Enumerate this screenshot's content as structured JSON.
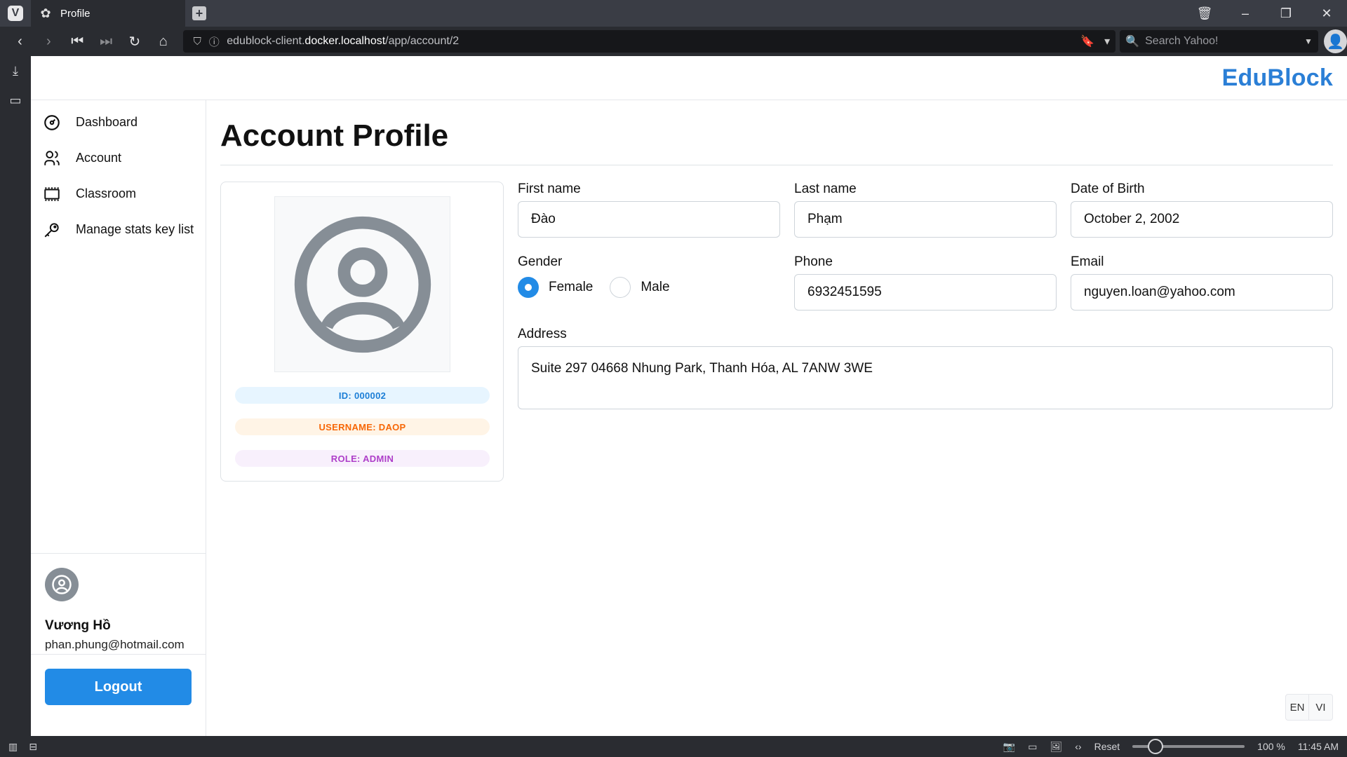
{
  "browser": {
    "tab_title": "Profile",
    "url_prefix": "edublock-client.",
    "url_host": "docker.localhost",
    "url_path": "/app/account/2",
    "search_placeholder": "Search Yahoo!",
    "zoom_reset": "Reset",
    "zoom_level": "100 %",
    "clock": "11:45 AM"
  },
  "app": {
    "brand": "EduBlock"
  },
  "sidebar": {
    "items": [
      {
        "label": "Dashboard",
        "icon": "dashboard-icon"
      },
      {
        "label": "Account",
        "icon": "users-icon"
      },
      {
        "label": "Classroom",
        "icon": "classroom-icon"
      },
      {
        "label": "Manage stats key list",
        "icon": "key-icon"
      }
    ],
    "user": {
      "name": "Vương Hồ",
      "email": "phan.phung@hotmail.com"
    },
    "logout_label": "Logout"
  },
  "main": {
    "title": "Account Profile",
    "profile": {
      "id_badge": "ID: 000002",
      "username_badge": "USERNAME: DAOP",
      "role_badge": "ROLE: ADMIN"
    },
    "form": {
      "first_name_label": "First name",
      "first_name": "Đào",
      "last_name_label": "Last name",
      "last_name": "Phạm",
      "dob_label": "Date of Birth",
      "dob": "October 2, 2002",
      "gender_label": "Gender",
      "gender_female": "Female",
      "gender_male": "Male",
      "phone_label": "Phone",
      "phone": "6932451595",
      "email_label": "Email",
      "email": "nguyen.loan@yahoo.com",
      "address_label": "Address",
      "address": "Suite 297 04668 Nhung Park, Thanh Hóa, AL 7ANW  3WE"
    }
  },
  "language": {
    "en": "EN",
    "vi": "VI"
  },
  "colors": {
    "brand": "#2b7fd6",
    "primary": "#228be6"
  }
}
